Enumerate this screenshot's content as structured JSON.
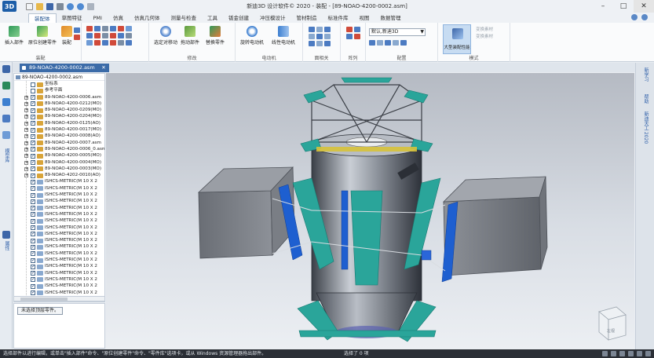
{
  "app": {
    "title": "新迪3D 设计软件© 2020 - 装配 - [89-NOAO-4200-0002.asm]",
    "logo_text": "3D"
  },
  "menu": {
    "tabs": [
      "装配体",
      "草图特征",
      "PMI",
      "仿真",
      "仿真几何体",
      "测量与检查",
      "工具",
      "钣金创建",
      "冲压模设计",
      "管材制造",
      "标准件库",
      "视图",
      "数据管理"
    ],
    "active_index": 0
  },
  "ribbon": {
    "groups": {
      "assembly": {
        "label": "装配",
        "insert_part": "插入部件",
        "create_in_place": "原位创建零件",
        "assemble": "装配"
      },
      "modify": {
        "label": "修改",
        "drag": "选定对移动",
        "move": "拖动部件",
        "replace": "替换零件"
      },
      "motor": {
        "label": "电动机",
        "rotary": "旋转电动机",
        "linear": "线性电动机"
      },
      "face_relation": {
        "label": "面相关"
      },
      "pattern": {
        "label": "阵列"
      },
      "config": {
        "label": "配置",
        "combo_value": "默认,新迪3D"
      },
      "mode": {
        "label": "模式",
        "large_assembly": "大型装配性能",
        "option1": "变换素材",
        "option2": "变换素材"
      }
    }
  },
  "document": {
    "tab_label": "89-NOAO-4200-0002.asm"
  },
  "tree": {
    "root": "89-NOAO-4200-0002.asm",
    "rows": [
      {
        "text": "坐标系",
        "plain": true,
        "checked": false
      },
      {
        "text": "参考平面",
        "plain": true,
        "checked": false
      },
      {
        "text": "89-NOAO-4200-0006.asm",
        "checked": true,
        "part": false
      },
      {
        "text": "89-NOAO-4200-0212(MO)",
        "checked": true,
        "part": false
      },
      {
        "text": "89-NOAO-4200-0209(MO)",
        "checked": true,
        "part": false
      },
      {
        "text": "89-NOAO-4200-0204(MO)",
        "checked": true,
        "part": false
      },
      {
        "text": "89-NOAO-4200-0125(AO)",
        "checked": true,
        "part": false
      },
      {
        "text": "89-NOAO-4200-0017(MO)",
        "checked": true,
        "part": false
      },
      {
        "text": "89-NOAO-4200-0008(AO)",
        "checked": true,
        "part": false
      },
      {
        "text": "89-NOAO-4200-0007.asm",
        "checked": true,
        "part": false
      },
      {
        "text": "89-NOAO-4200-0006_0.asm",
        "checked": true,
        "part": false
      },
      {
        "text": "89-NOAO-4200-0005(MO)",
        "checked": true,
        "part": false
      },
      {
        "text": "89-NOAO-4200-0004(MO)",
        "checked": true,
        "part": false
      },
      {
        "text": "89-NOAO-4200-0003(MO)",
        "checked": true,
        "part": false
      },
      {
        "text": "89-NOAO-4202-0010(AO)",
        "checked": true,
        "part": false
      },
      {
        "text": "ISHCS-METRIC(M 10 X 2",
        "checked": true,
        "part": true
      },
      {
        "text": "ISHCS-METRIC(M 10 X 2",
        "checked": true,
        "part": true
      },
      {
        "text": "ISHCS-METRIC(M 10 X 2",
        "checked": true,
        "part": true
      },
      {
        "text": "ISHCS-METRIC(M 10 X 2",
        "checked": true,
        "part": true
      },
      {
        "text": "ISHCS-METRIC(M 10 X 2",
        "checked": true,
        "part": true
      },
      {
        "text": "ISHCS-METRIC(M 10 X 2",
        "checked": true,
        "part": true
      },
      {
        "text": "ISHCS-METRIC(M 10 X 2",
        "checked": true,
        "part": true
      },
      {
        "text": "ISHCS-METRIC(M 10 X 2",
        "checked": true,
        "part": true
      },
      {
        "text": "ISHCS-METRIC(M 10 X 2",
        "checked": true,
        "part": true
      },
      {
        "text": "ISHCS-METRIC(M 10 X 2",
        "checked": true,
        "part": true
      },
      {
        "text": "ISHCS-METRIC(M 10 X 2",
        "checked": true,
        "part": true
      },
      {
        "text": "ISHCS-METRIC(M 10 X 2",
        "checked": true,
        "part": true
      },
      {
        "text": "ISHCS-METRIC(M 10 X 2",
        "checked": true,
        "part": true
      },
      {
        "text": "ISHCS-METRIC(M 10 X 2",
        "checked": true,
        "part": true
      },
      {
        "text": "ISHCS-METRIC(M 10 X 2",
        "checked": true,
        "part": true
      },
      {
        "text": "ISHCS-METRIC(M 10 X 2",
        "checked": true,
        "part": true
      },
      {
        "text": "ISHCS-METRIC(M 10 X 2",
        "checked": true,
        "part": true
      },
      {
        "text": "ISHCS-METRIC(M 10 X 2",
        "checked": true,
        "part": true
      }
    ],
    "bottom_button": "未选择顶层零件。"
  },
  "left_toolbar": {
    "label1": "模型库",
    "label2": "属性"
  },
  "right_panel": {
    "label1": "新学习",
    "label2": "帮助",
    "label3": "新迪天工 2020"
  },
  "viewcube": {
    "label": "左视"
  },
  "status": {
    "message": "选择部件以进行编辑，或单击\"插入部件\"命令、\"原位创建零件\"命令、\"零件库\"选项卡，或从 Windows 资源管理器拖出部件。",
    "selection": "选择了 0 项"
  },
  "colors": {
    "accent": "#3b6ba8",
    "teal": "#2aa59a",
    "blue_part": "#1e5fd0",
    "status_bg": "#2b2f36"
  }
}
